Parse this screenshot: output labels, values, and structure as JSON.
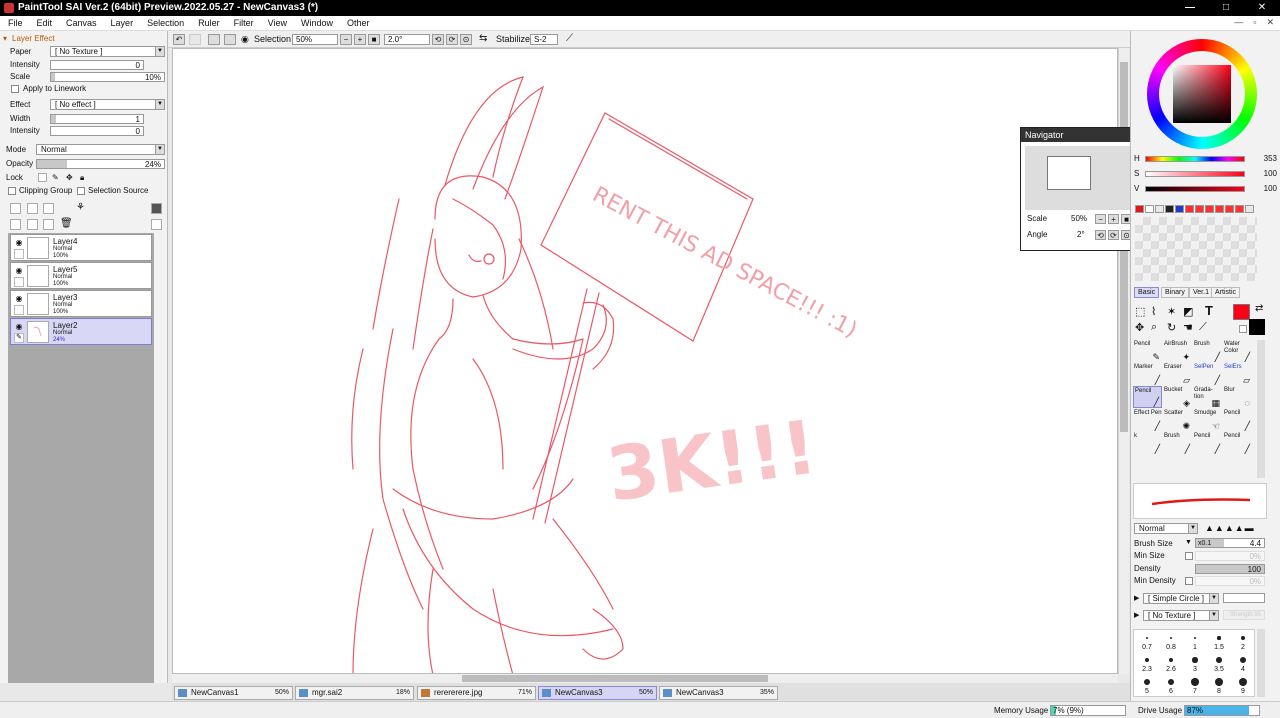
{
  "window": {
    "title": "PaintTool SAI Ver.2 (64bit) Preview.2022.05.27 - NewCanvas3 (*)",
    "min": "—",
    "max": "□",
    "close": "✕"
  },
  "menu": [
    "File",
    "Edit",
    "Canvas",
    "Layer",
    "Selection",
    "Ruler",
    "Filter",
    "View",
    "Window",
    "Other"
  ],
  "mdi": {
    "min": "—",
    "restore": "▫",
    "close": "✕"
  },
  "layer_effect": {
    "header": "Layer Effect",
    "paper_label": "Paper",
    "paper_value": "[ No Texture ]",
    "intensity_label": "Intensity",
    "intensity_value": "0",
    "scale_label": "Scale",
    "scale_value": "10%",
    "apply_linework": "Apply to Linework",
    "effect_label": "Effect",
    "effect_value": "[ No effect ]",
    "width_label": "Width",
    "width_value": "1",
    "intensity2_label": "Intensity",
    "intensity2_value": "0"
  },
  "layer_props": {
    "mode_label": "Mode",
    "mode_value": "Normal",
    "opacity_label": "Opacity",
    "opacity_value": "24%",
    "opacity_level": 0.24,
    "lock_label": "Lock",
    "clipping_group": "Clipping Group",
    "selection_source": "Selection Source"
  },
  "layers": [
    {
      "name": "Layer4",
      "mode": "Normal",
      "opacity": "100%",
      "selected": false
    },
    {
      "name": "Layer5",
      "mode": "Normal",
      "opacity": "100%",
      "selected": false
    },
    {
      "name": "Layer3",
      "mode": "Normal",
      "opacity": "100%",
      "selected": false
    },
    {
      "name": "Layer2",
      "mode": "Normal",
      "opacity": "24%",
      "selected": true
    }
  ],
  "toolbar": {
    "selection_label": "Selection",
    "zoom_value": "50%",
    "angle_value": "2.0°",
    "stabilizer_label": "Stabilizer",
    "stabilizer_value": "S-2"
  },
  "canvas_text": {
    "sign": "RENT THIS AD SPACE!!! :1)",
    "big": "3K!!!"
  },
  "navigator": {
    "title": "Navigator",
    "scale_label": "Scale",
    "scale_value": "50%",
    "angle_label": "Angle",
    "angle_value": "2°"
  },
  "color": {
    "h_label": "H",
    "h_value": "353",
    "s_label": "S",
    "s_value": "100",
    "v_label": "V",
    "v_value": "100",
    "primary": "#ff0019",
    "swatches": [
      "#e01818",
      "#ffffff",
      "#e8e8e8",
      "#222222",
      "#1e3cc8",
      "#ff2a2a",
      "#ff3030",
      "#ff3030",
      "#ff3030",
      "#ff3030",
      "#ff3030",
      "#e8e8e8"
    ]
  },
  "tool_tabs": [
    "Basic",
    "Binary",
    "Ver.1",
    "Artistic"
  ],
  "tools": [
    {
      "label": "Pencil",
      "glyph": "✎"
    },
    {
      "label": "AirBrush",
      "glyph": "✦"
    },
    {
      "label": "Brush",
      "glyph": "╱"
    },
    {
      "label": "Water Color",
      "glyph": "╱"
    },
    {
      "label": "Marker",
      "glyph": "╱"
    },
    {
      "label": "Eraser",
      "glyph": "▱"
    },
    {
      "label": "SelPen",
      "glyph": "╱"
    },
    {
      "label": "SelErs",
      "glyph": "▱"
    },
    {
      "label": "Pencil",
      "glyph": "╱"
    },
    {
      "label": "Bucket",
      "glyph": "◈"
    },
    {
      "label": "Grada-tion",
      "glyph": "▦"
    },
    {
      "label": "Blur",
      "glyph": "◌"
    },
    {
      "label": "Effect Pen",
      "glyph": "╱"
    },
    {
      "label": "Scatter",
      "glyph": "✺"
    },
    {
      "label": "Smudge",
      "glyph": "☜"
    },
    {
      "label": "Pencil",
      "glyph": "╱"
    },
    {
      "label": "k",
      "glyph": "╱"
    },
    {
      "label": "Brush",
      "glyph": "╱"
    },
    {
      "label": "Pencil",
      "glyph": "╱"
    },
    {
      "label": "Pencil",
      "glyph": "╱"
    }
  ],
  "brush": {
    "mode_value": "Normal",
    "size_label": "Brush Size",
    "size_mult": "x0.1",
    "size_value": "4.4",
    "min_size_label": "Min Size",
    "min_size_value": "0%",
    "density_label": "Density",
    "density_value": "100",
    "min_density_label": "Min Density",
    "min_density_value": "0%",
    "shape_value": "[ Simple Circle ]",
    "texture_value": "[ No Texture ]",
    "texture_strength": "Strength 95"
  },
  "brush_sizes": [
    "0.7",
    "0.8",
    "1",
    "1.5",
    "2",
    "2.3",
    "2.6",
    "3",
    "3.5",
    "4",
    "5",
    "6",
    "7",
    "8",
    "9"
  ],
  "doc_tabs": [
    {
      "name": "NewCanvas1",
      "zoom": "50%"
    },
    {
      "name": "mgr.sai2",
      "zoom": "18%"
    },
    {
      "name": "rerererere.jpg",
      "zoom": "71%"
    },
    {
      "name": "NewCanvas3",
      "zoom": "50%",
      "selected": true
    },
    {
      "name": "NewCanvas3",
      "zoom": "35%"
    }
  ],
  "status": {
    "memory_label": "Memory Usage",
    "memory_value": "7% (9%)",
    "memory_level": 0.07,
    "drive_label": "Drive Usage",
    "drive_value": "87%",
    "drive_level": 0.87
  }
}
